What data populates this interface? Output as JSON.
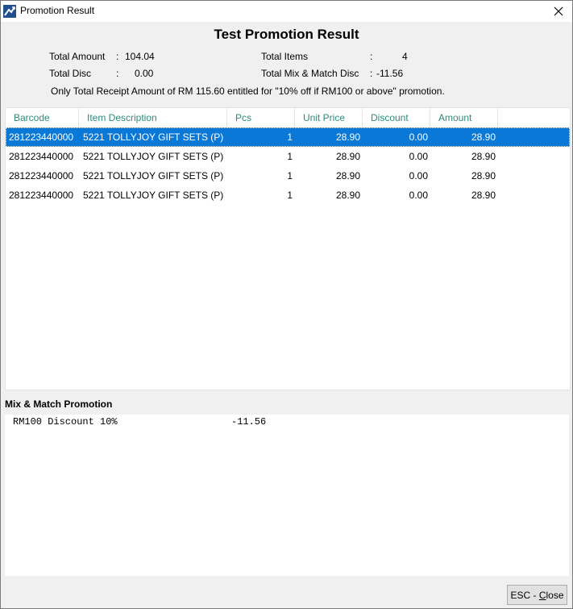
{
  "window": {
    "title": "Promotion Result"
  },
  "heading": "Test Promotion Result",
  "summary": {
    "total_amount_label": "Total Amount",
    "total_amount_value": "104.04",
    "total_disc_label": "Total Disc",
    "total_disc_value": "0.00",
    "total_items_label": "Total Items",
    "total_items_value": "4",
    "total_mm_label": "Total Mix & Match Disc",
    "total_mm_value": "-11.56",
    "note": "Only Total Receipt Amount of RM 115.60 entitled for \"10% off if RM100 or above\" promotion."
  },
  "table": {
    "columns": [
      "Barcode",
      "Item Description",
      "Pcs",
      "Unit Price",
      "Discount",
      "Amount"
    ],
    "rows": [
      {
        "barcode": "281223440000",
        "description": "5221 TOLLYJOY GIFT SETS (P)",
        "pcs": "1",
        "unit_price": "28.90",
        "discount": "0.00",
        "amount": "28.90"
      },
      {
        "barcode": "281223440000",
        "description": "5221 TOLLYJOY GIFT SETS (P)",
        "pcs": "1",
        "unit_price": "28.90",
        "discount": "0.00",
        "amount": "28.90"
      },
      {
        "barcode": "281223440000",
        "description": "5221 TOLLYJOY GIFT SETS (P)",
        "pcs": "1",
        "unit_price": "28.90",
        "discount": "0.00",
        "amount": "28.90"
      },
      {
        "barcode": "281223440000",
        "description": "5221 TOLLYJOY GIFT SETS (P)",
        "pcs": "1",
        "unit_price": "28.90",
        "discount": "0.00",
        "amount": "28.90"
      }
    ]
  },
  "mix_match": {
    "title": "Mix & Match Promotion",
    "lines": [
      {
        "label": "RM100 Discount 10%",
        "value": "-11.56"
      }
    ]
  },
  "buttons": {
    "close_prefix": "ESC - ",
    "close_key": "C",
    "close_rest": "lose"
  },
  "colors": {
    "header_text": "#2e8b7a",
    "selection": "#0a78d7"
  },
  "icons": {
    "app": "app-logo-icon",
    "close": "close-icon"
  }
}
